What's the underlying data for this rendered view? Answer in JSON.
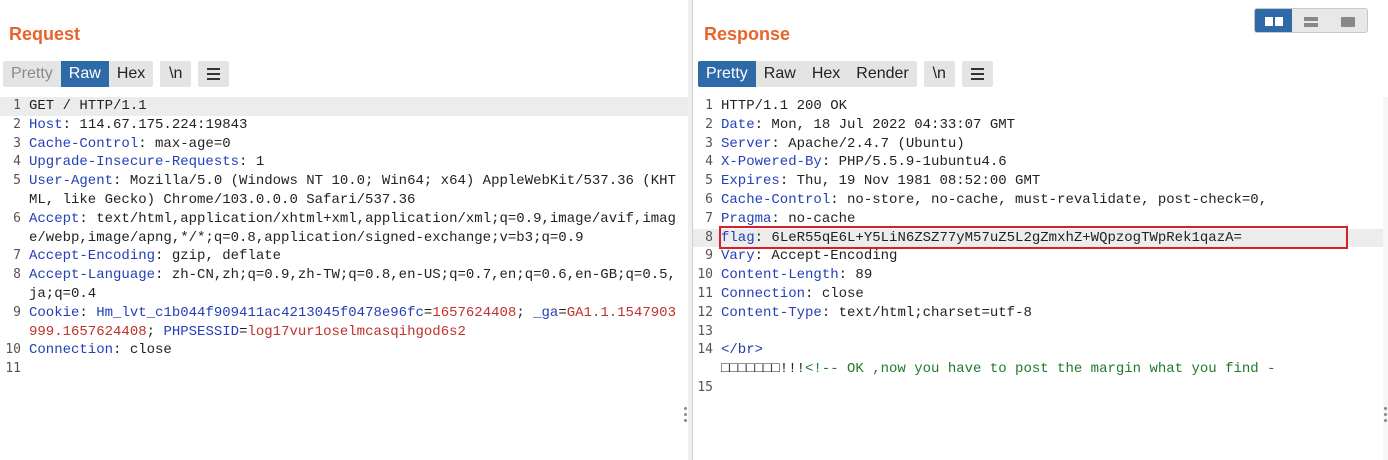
{
  "layout_toggle": {
    "options": [
      "side-by-side-icon",
      "stacked-rows-icon",
      "single-pane-icon"
    ],
    "active": 0
  },
  "colors": {
    "accent": "#e8642c",
    "active_tab": "#2e6aa8",
    "header_name": "#2340b8",
    "cookie_value": "#c0312b",
    "highlight_box": "#d81f26",
    "comment": "#1f7a2a"
  },
  "request": {
    "title": "Request",
    "tabs": [
      "Pretty",
      "Raw",
      "Hex"
    ],
    "active_tab": "Raw",
    "newline_button": "\\n",
    "menu_icon": "hamburger-icon",
    "lines": [
      {
        "n": "1",
        "text": "GET / HTTP/1.1"
      },
      {
        "n": "2",
        "name": "Host",
        "value": " 114.67.175.224:19843"
      },
      {
        "n": "3",
        "name": "Cache-Control",
        "value": " max-age=0"
      },
      {
        "n": "4",
        "name": "Upgrade-Insecure-Requests",
        "value": " 1"
      },
      {
        "n": "5",
        "name": "User-Agent",
        "value": " Mozilla/5.0 (Windows NT 10.0; Win64; x64) AppleWebKit/537.36 (KHTML, like Gecko) Chrome/103.0.0.0 Safari/537.36"
      },
      {
        "n": "6",
        "name": "Accept",
        "value": " text/html,application/xhtml+xml,application/xml;q=0.9,image/avif,image/webp,image/apng,*/*;q=0.8,application/signed-exchange;v=b3;q=0.9"
      },
      {
        "n": "7",
        "name": "Accept-Encoding",
        "value": " gzip, deflate"
      },
      {
        "n": "8",
        "name": "Accept-Language",
        "value": " zh-CN,zh;q=0.9,zh-TW;q=0.8,en-US;q=0.7,en;q=0.6,en-GB;q=0.5,ja;q=0.4"
      },
      {
        "n": "9",
        "name": "Cookie",
        "cookies": [
          {
            "name": "Hm_lvt_c1b044f909411ac4213045f0478e96fc",
            "value": "1657624408"
          },
          {
            "name": "_ga",
            "value": "GA1.1.1547903999.1657624408"
          },
          {
            "name": "PHPSESSID",
            "value": "log17vur1oselmcasqihgod6s2"
          }
        ]
      },
      {
        "n": "10",
        "name": "Connection",
        "value": " close"
      },
      {
        "n": "11",
        "text": ""
      }
    ]
  },
  "response": {
    "title": "Response",
    "tabs": [
      "Pretty",
      "Raw",
      "Hex",
      "Render"
    ],
    "active_tab": "Pretty",
    "newline_button": "\\n",
    "menu_icon": "hamburger-icon",
    "lines": [
      {
        "n": "1",
        "text": "HTTP/1.1 200 OK"
      },
      {
        "n": "2",
        "name": "Date",
        "value": " Mon, 18 Jul 2022 04:33:07 GMT"
      },
      {
        "n": "3",
        "name": "Server",
        "value": " Apache/2.4.7 (Ubuntu)"
      },
      {
        "n": "4",
        "name": "X-Powered-By",
        "value": " PHP/5.5.9-1ubuntu4.6"
      },
      {
        "n": "5",
        "name": "Expires",
        "value": " Thu, 19 Nov 1981 08:52:00 GMT"
      },
      {
        "n": "6",
        "name": "Cache-Control",
        "value": " no-store, no-cache, must-revalidate, post-check=0,"
      },
      {
        "n": "7",
        "name": "Pragma",
        "value": " no-cache"
      },
      {
        "n": "8",
        "name": "flag",
        "value": " 6LeR55qE6L+Y5LiN6ZSZ77yM57uZ5L2gZmxhZ+WQpzogTWpRek1qazA=",
        "highlight": true
      },
      {
        "n": "9",
        "name": "Vary",
        "value": " Accept-Encoding"
      },
      {
        "n": "10",
        "name": "Content-Length",
        "value": " 89"
      },
      {
        "n": "11",
        "name": "Connection",
        "value": " close"
      },
      {
        "n": "12",
        "name": "Content-Type",
        "value": " text/html;charset=utf-8"
      },
      {
        "n": "13",
        "text": ""
      },
      {
        "n": "14",
        "html_tag": "</br>",
        "after": "",
        "body_text": "□□□□□□□!!!",
        "comment": "<!-- OK ,now you have to post the margin what you find -"
      },
      {
        "n": "15",
        "text": ""
      }
    ]
  }
}
